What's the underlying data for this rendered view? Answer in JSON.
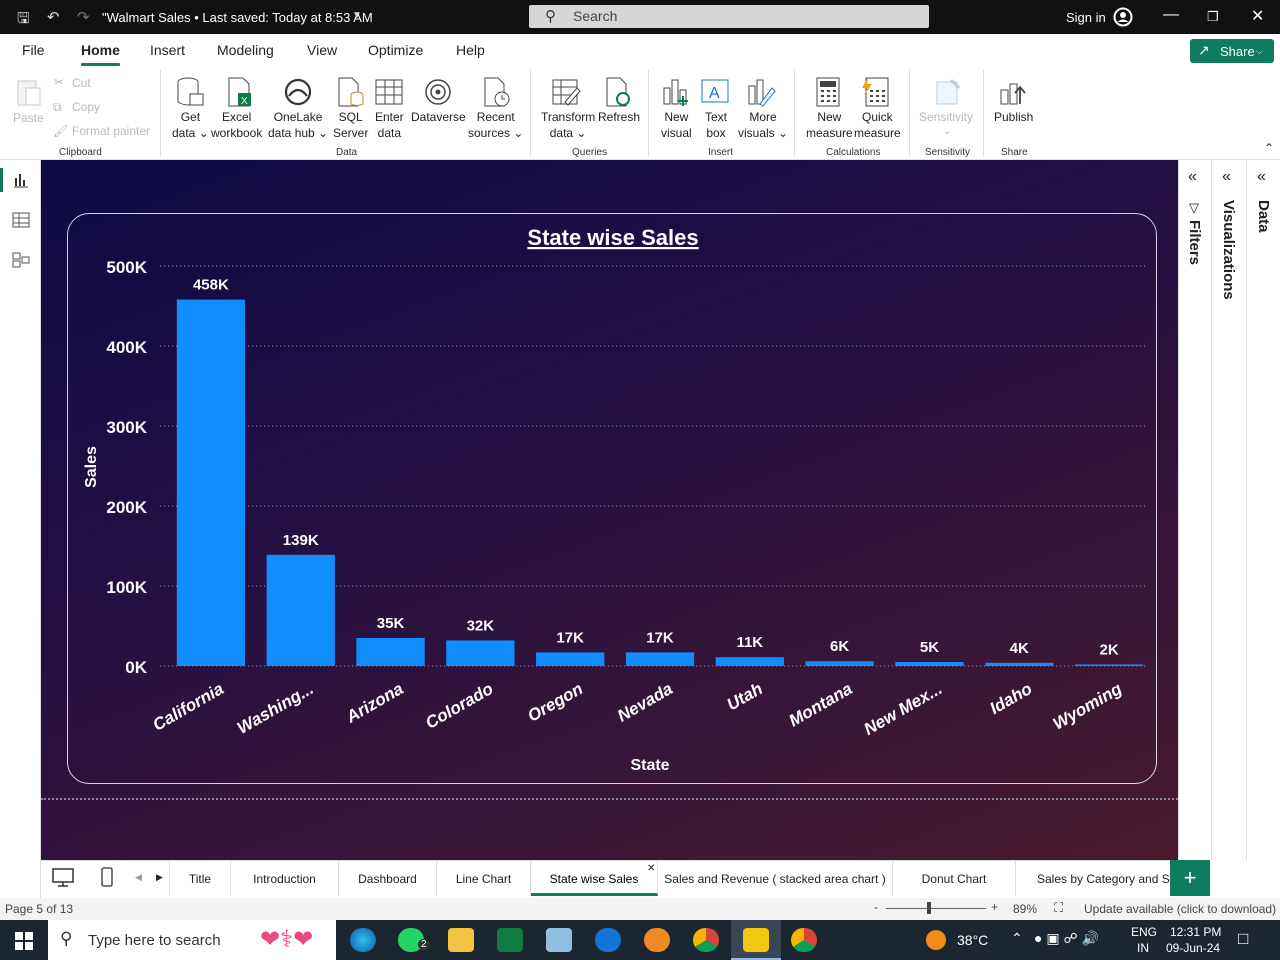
{
  "titlebar": {
    "doc_title": "\"Walmart Sales • Last saved: Today at 8:53 AM",
    "search_placeholder": "Search",
    "signin": "Sign in"
  },
  "menu": [
    "File",
    "Home",
    "Insert",
    "Modeling",
    "View",
    "Optimize",
    "Help"
  ],
  "share_label": "Share",
  "ribbon": {
    "clipboard": {
      "paste": "Paste",
      "cut": "Cut",
      "copy": "Copy",
      "format_painter": "Format painter",
      "group": "Clipboard"
    },
    "data": {
      "get_data": [
        "Get",
        "data ⌄"
      ],
      "excel": [
        "Excel",
        "workbook"
      ],
      "onelake": [
        "OneLake",
        "data hub ⌄"
      ],
      "sql": [
        "SQL",
        "Server"
      ],
      "enter": [
        "Enter",
        "data"
      ],
      "dataverse": "Dataverse",
      "recent": [
        "Recent",
        "sources ⌄"
      ],
      "group": "Data"
    },
    "queries": {
      "transform": [
        "Transform",
        "data ⌄"
      ],
      "refresh": "Refresh",
      "group": "Queries"
    },
    "insert": {
      "new_visual": [
        "New",
        "visual"
      ],
      "text_box": [
        "Text",
        "box"
      ],
      "more_visuals": [
        "More",
        "visuals ⌄"
      ],
      "group": "Insert"
    },
    "calculations": {
      "new_measure": [
        "New",
        "measure"
      ],
      "quick_measure": [
        "Quick",
        "measure"
      ],
      "group": "Calculations"
    },
    "sensitivity": {
      "label": "Sensitivity",
      "group": "Sensitivity"
    },
    "share": {
      "publish": "Publish",
      "group": "Share"
    }
  },
  "panes": {
    "filters": "Filters",
    "visualizations": "Visualizations",
    "data": "Data"
  },
  "chart_data": {
    "type": "bar",
    "title": "State wise Sales",
    "xlabel": "State",
    "ylabel": "Sales",
    "categories": [
      "California",
      "Washing...",
      "Arizona",
      "Colorado",
      "Oregon",
      "Nevada",
      "Utah",
      "Montana",
      "New Mex...",
      "Idaho",
      "Wyoming"
    ],
    "values": [
      458000,
      139000,
      35000,
      32000,
      17000,
      17000,
      11000,
      6000,
      5000,
      4000,
      2000
    ],
    "data_labels": [
      "458K",
      "139K",
      "35K",
      "32K",
      "17K",
      "17K",
      "11K",
      "6K",
      "5K",
      "4K",
      "2K"
    ],
    "yticks": [
      "0K",
      "100K",
      "200K",
      "300K",
      "400K",
      "500K"
    ],
    "ylim": [
      0,
      500000
    ],
    "grid": true,
    "bar_color": "#118dff"
  },
  "tabs": [
    "Title",
    "Introduction",
    "Dashboard",
    "Line Chart",
    "State wise Sales",
    "Sales and Revenue ( stacked area chart )",
    "Donut Chart",
    "Sales by Category and Su"
  ],
  "active_tab": "State wise Sales",
  "status": {
    "page": "Page 5 of 13",
    "zoom": "89%",
    "update": "Update available (click to download)"
  },
  "taskbar": {
    "search": "Type here to search",
    "weather": "38°C",
    "lang": [
      "ENG",
      "IN"
    ],
    "time": "12:31 PM",
    "date": "09-Jun-24",
    "whatsapp_badge": "2"
  },
  "colors": {
    "accent": "#0f7b5f",
    "bar": "#118dff"
  }
}
